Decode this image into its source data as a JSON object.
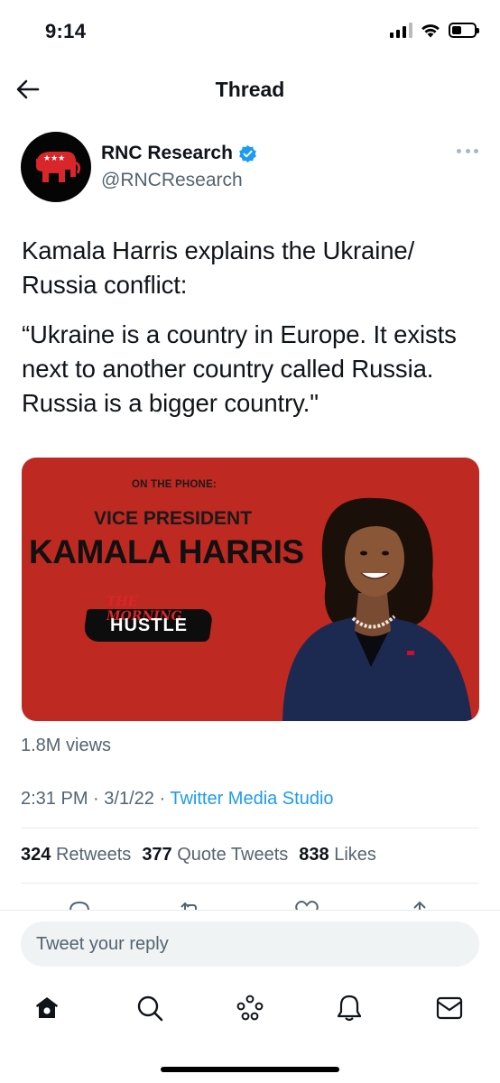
{
  "status_bar": {
    "time": "9:14"
  },
  "header": {
    "title": "Thread"
  },
  "tweet": {
    "author": {
      "name": "RNC Research",
      "handle": "@RNCResearch",
      "verified": true,
      "avatar_icon": "rnc-elephant-icon"
    },
    "text_lines": [
      "Kamala Harris explains the Ukraine/ Russia conflict:",
      "“Ukraine is a country in Europe. It exists next to another country called Russia. Russia is a bigger country.\""
    ],
    "media": {
      "subtitle": "ON THE PHONE:",
      "kicker": "VICE PRESIDENT",
      "headline": "KAMALA HARRIS",
      "show_logo_top": "THE MORNING",
      "show_logo_bottom": "HUSTLE",
      "background_color": "#be2921"
    },
    "views": "1.8M views",
    "time": "2:31 PM",
    "date": "3/1/22",
    "separator": "·",
    "source": "Twitter Media Studio",
    "stats": {
      "retweets": {
        "count": "324",
        "label": "Retweets"
      },
      "quotes": {
        "count": "377",
        "label": "Quote Tweets"
      },
      "likes": {
        "count": "838",
        "label": "Likes"
      }
    }
  },
  "reply": {
    "placeholder": "Tweet your reply"
  },
  "nav": {
    "items": [
      "home-icon",
      "search-icon",
      "spaces-icon",
      "notifications-icon",
      "messages-icon"
    ]
  },
  "colors": {
    "accent": "#1d9bf0",
    "secondary_text": "#536471",
    "media_red": "#be2921"
  }
}
